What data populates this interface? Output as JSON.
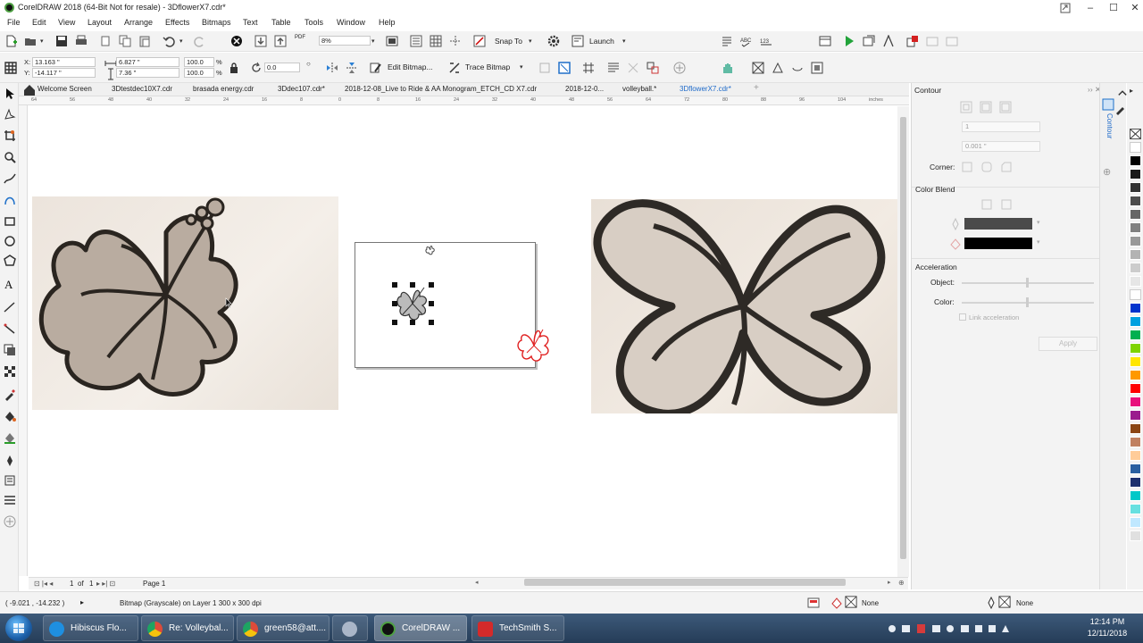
{
  "window": {
    "title": "CorelDRAW 2018 (64-Bit Not for resale) - 3DflowerX7.cdr*",
    "minimize": "–",
    "maximize": "☐",
    "close": "✕"
  },
  "menu": [
    "File",
    "Edit",
    "View",
    "Layout",
    "Arrange",
    "Effects",
    "Bitmaps",
    "Text",
    "Table",
    "Tools",
    "Window",
    "Help"
  ],
  "standard_toolbar": {
    "zoom_value": "8%",
    "snap_to_label": "Snap To",
    "launch_label": "Launch",
    "pdf_label": "PDF"
  },
  "property_bar": {
    "x": "13.163 \"",
    "y": "-14.117 \"",
    "width": "6.827 \"",
    "height": "7.36 \"",
    "scale_w": "100.0",
    "scale_h": "100.0",
    "pct": "%",
    "rotation": "0.0",
    "edit_bitmap_label": "Edit Bitmap...",
    "trace_bitmap_label": "Trace Bitmap"
  },
  "doc_tabs": [
    {
      "label": "Welcome Screen",
      "active": false
    },
    {
      "label": "3Dtestdec10X7.cdr",
      "active": false
    },
    {
      "label": "brasada energy.cdr",
      "active": false
    },
    {
      "label": "3Ddec107.cdr*",
      "active": false
    },
    {
      "label": "2018-12-08_Live to Ride & AA Monogram_ETCH_CD X7.cdr",
      "active": false
    },
    {
      "label": "2018-12-0...",
      "active": false
    },
    {
      "label": "volleyball.*",
      "active": false
    },
    {
      "label": "3DflowerX7.cdr*",
      "active": true
    }
  ],
  "ruler": {
    "unit": "inches",
    "ticks": [
      "64",
      "56",
      "48",
      "40",
      "32",
      "24",
      "16",
      "8",
      "0",
      "8",
      "16",
      "24",
      "32",
      "40",
      "48",
      "56",
      "64",
      "72",
      "80",
      "88",
      "96",
      "104",
      "112"
    ]
  },
  "docker": {
    "title": "Contour",
    "steps": "1",
    "offset": "0.001 \"",
    "corner_label": "Corner:",
    "color_blend_label": "Color Blend",
    "outline_color": "#4a4a4a",
    "fill_color": "#000000",
    "acceleration_label": "Acceleration",
    "object_label": "Object:",
    "color_label": "Color:",
    "link_acceleration": "Link acceleration",
    "apply_label": "Apply",
    "side_tab": "Contour"
  },
  "page_nav": {
    "page_current": "1",
    "of_label": "of",
    "page_total": "1",
    "page_tab": "Page 1"
  },
  "status": {
    "coords": "( -9.021 , -14.232 )",
    "info": "Bitmap (Grayscale) on Layer 1 300 x 300 dpi",
    "fill_label": "None",
    "outline_label": "None"
  },
  "palette": [
    "#ffffff",
    "#000000",
    "#1a1a1a",
    "#333333",
    "#4d4d4d",
    "#666666",
    "#808080",
    "#999999",
    "#b3b3b3",
    "#cccccc",
    "#e6e6e6",
    "#ffffff",
    "#0033cc",
    "#00a0e0",
    "#00b050",
    "#7fd400",
    "#ffe600",
    "#ff9900",
    "#ff0000",
    "#e8127c",
    "#9b1c8e",
    "#8b4513",
    "#c08060",
    "#ffcc99",
    "#2a5fa0",
    "#1c2f6e",
    "#00c8c8",
    "#66e0e0",
    "#c0e8ff",
    "#e0e0e0"
  ],
  "taskbar": {
    "tasks": [
      {
        "label": "Hibiscus Flo...",
        "color": "#1e8fe0"
      },
      {
        "label": "Re: Volleybal...",
        "color": "#dd4b39"
      },
      {
        "label": "green58@att....",
        "color": "#dd4b39"
      },
      {
        "label": "",
        "color": "#aab6c8"
      },
      {
        "label": "CorelDRAW ...",
        "color": "#111111"
      },
      {
        "label": "TechSmith S...",
        "color": "#d42a2a"
      }
    ],
    "time": "12:14 PM",
    "date": "12/11/2018"
  }
}
